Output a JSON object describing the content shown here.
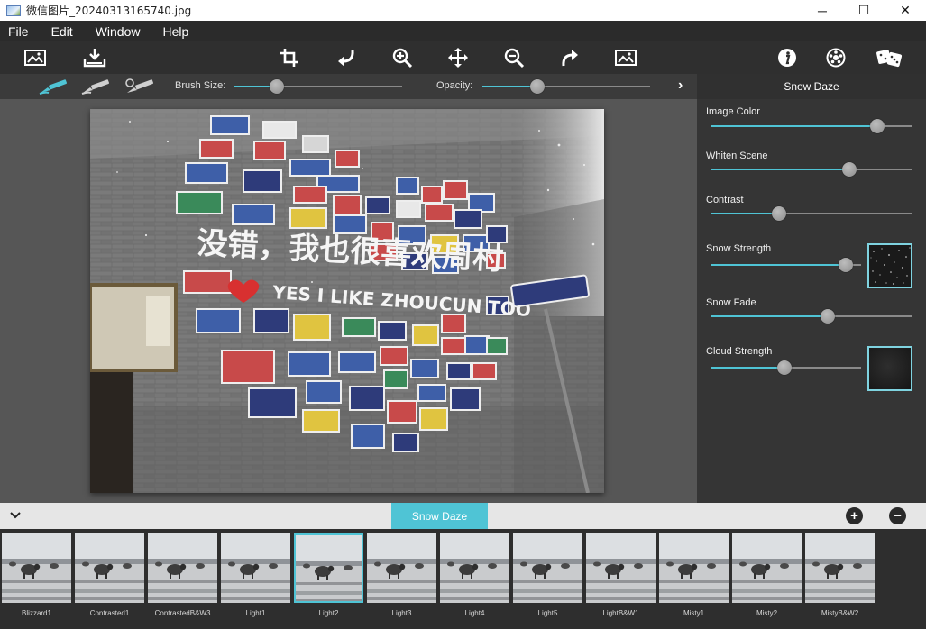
{
  "window": {
    "title": "微信图片_20240313165740.jpg",
    "icon": "image-file-icon",
    "controls": {
      "minimize": "─",
      "maximize": "☐",
      "close": "✕"
    }
  },
  "menu": [
    "File",
    "Edit",
    "Window",
    "Help"
  ],
  "toolbar": {
    "left": [
      "open-image-icon",
      "save-image-icon"
    ],
    "center": [
      "crop-icon",
      "undo-icon",
      "zoom-in-icon",
      "pan-icon",
      "zoom-out-icon",
      "redo-icon",
      "fit-to-window-icon"
    ],
    "right": [
      "info-icon",
      "effects-icon",
      "random-dice-icon"
    ]
  },
  "brush_bar": {
    "brush_icons": [
      "brush-apply-icon",
      "brush-erase-icon",
      "brush-reset-icon"
    ],
    "brush_size_label": "Brush Size:",
    "brush_size_value": 0.25,
    "opacity_label": "Opacity:",
    "opacity_value": 0.33,
    "expand_arrow": "›"
  },
  "panel": {
    "title": "Snow Daze",
    "controls": [
      {
        "label": "Image Color",
        "value": 0.83,
        "has_thumb": false
      },
      {
        "label": "Whiten Scene",
        "value": 0.69,
        "has_thumb": false
      },
      {
        "label": "Contrast",
        "value": 0.34,
        "has_thumb": false
      },
      {
        "label": "Snow Strength",
        "value": 0.9,
        "has_thumb": true,
        "thumb": "snow-texture"
      },
      {
        "label": "Snow Fade",
        "value": 0.58,
        "has_thumb": false
      },
      {
        "label": "Cloud Strength",
        "value": 0.49,
        "has_thumb": true,
        "thumb": "cloud-texture"
      }
    ]
  },
  "photo": {
    "signs_main": "没错，我也很喜欢周村",
    "signs_english": "YES I LIKE ZHOUCUN TOO"
  },
  "presets_header": {
    "active_tab": "Snow Daze",
    "add": "+",
    "remove": "−"
  },
  "presets": [
    {
      "name": "Blizzard1",
      "selected": false
    },
    {
      "name": "Contrasted1",
      "selected": false
    },
    {
      "name": "ContrastedB&W3",
      "selected": false
    },
    {
      "name": "Light1",
      "selected": false
    },
    {
      "name": "Light2",
      "selected": true
    },
    {
      "name": "Light3",
      "selected": false
    },
    {
      "name": "Light4",
      "selected": false
    },
    {
      "name": "Light5",
      "selected": false
    },
    {
      "name": "LightB&W1",
      "selected": false
    },
    {
      "name": "Misty1",
      "selected": false
    },
    {
      "name": "Misty2",
      "selected": false
    },
    {
      "name": "MistyB&W2",
      "selected": false
    }
  ],
  "colors": {
    "accent": "#4fc4d5",
    "toolbar_bg": "#2f2f2f",
    "panel_bg": "#353535",
    "workspace_bg": "#565656"
  }
}
